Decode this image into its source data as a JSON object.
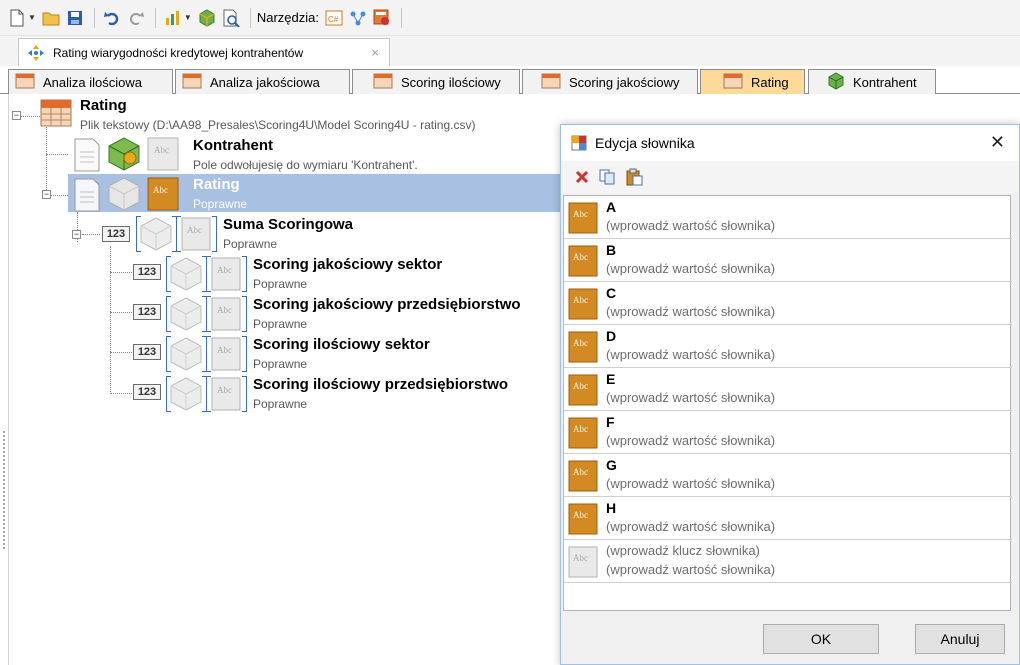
{
  "toolbar": {
    "tools_label": "Narzędzia:",
    "icons": [
      "new-file-icon",
      "open-folder-icon",
      "save-icon",
      "undo-icon",
      "redo-icon",
      "chart-icon",
      "cube-icon",
      "preview-icon",
      "csharp-icon",
      "hierarchy-icon",
      "settings-icon"
    ]
  },
  "document_tab": {
    "title": "Rating wiarygodności kredytowej kontrahentów",
    "close": "×"
  },
  "page_tabs": [
    {
      "label": "Analiza ilościowa"
    },
    {
      "label": "Analiza jakościowa"
    },
    {
      "label": "Scoring ilościowy"
    },
    {
      "label": "Scoring jakościowy"
    },
    {
      "label": "Rating",
      "active": true
    },
    {
      "label": "Kontrahent"
    }
  ],
  "tree": {
    "root": {
      "title": "Rating",
      "subtitle": "Plik tekstowy (D:\\AA98_Presales\\Scoring4U\\Model Scoring4U - rating.csv)"
    },
    "kontrahent": {
      "title": "Kontrahent",
      "subtitle": "Pole odwołujesię do wymiaru 'Kontrahent'."
    },
    "rating": {
      "title": "Rating",
      "subtitle": "Poprawne"
    },
    "suma": {
      "title": "Suma Scoringowa",
      "subtitle": "Poprawne",
      "badge": "123"
    },
    "children": [
      {
        "title": "Scoring jakościowy sektor",
        "subtitle": "Poprawne",
        "badge": "123"
      },
      {
        "title": "Scoring jakościowy przedsiębiorstwo",
        "subtitle": "Poprawne",
        "badge": "123"
      },
      {
        "title": "Scoring ilościowy sektor",
        "subtitle": "Poprawne",
        "badge": "123"
      },
      {
        "title": "Scoring ilościowy przedsiębiorstwo",
        "subtitle": "Poprawne",
        "badge": "123"
      }
    ]
  },
  "dialog": {
    "title": "Edycja słownika",
    "close": "✕",
    "items": [
      {
        "key": "A",
        "value": "(wprowadź wartość słownika)"
      },
      {
        "key": "B",
        "value": "(wprowadź wartość słownika)"
      },
      {
        "key": "C",
        "value": "(wprowadź wartość słownika)"
      },
      {
        "key": "D",
        "value": "(wprowadź wartość słownika)"
      },
      {
        "key": "E",
        "value": "(wprowadź wartość słownika)"
      },
      {
        "key": "F",
        "value": "(wprowadź wartość słownika)"
      },
      {
        "key": "G",
        "value": "(wprowadź wartość słownika)"
      },
      {
        "key": "H",
        "value": "(wprowadź wartość słownika)"
      }
    ],
    "new_item": {
      "key_placeholder": "(wprowadź klucz słownika)",
      "value_placeholder": "(wprowadź wartość słownika)"
    },
    "ok": "OK",
    "cancel": "Anuluj"
  },
  "colors": {
    "selection": "#a8c0e2",
    "active_tab": "#fdd99a",
    "accent_red": "#d0312d"
  }
}
